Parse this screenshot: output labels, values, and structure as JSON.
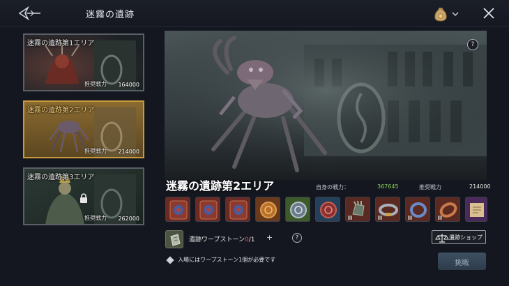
{
  "header": {
    "title": "迷霧の遺跡",
    "back_icon": "back-arrow-icon",
    "currency_icon": "money-bag-icon",
    "close_icon": "close-icon"
  },
  "areas": [
    {
      "name": "迷霧の遺跡第1エリア",
      "power_label": "推奨戦力",
      "power": "164000",
      "selected": false,
      "locked": false
    },
    {
      "name": "迷霧の遺跡第2エリア",
      "power_label": "推奨戦力",
      "power": "214000",
      "selected": true,
      "locked": false
    },
    {
      "name": "迷霧の遺跡第3エリア",
      "power_label": "推奨戦力",
      "power": "262000",
      "selected": false,
      "locked": true
    }
  ],
  "stage": {
    "title": "迷霧の遺跡第2エリア",
    "self_power_label": "自身の戦力：",
    "self_power": "367645",
    "recommended_label": "推奨戦力",
    "recommended": "214000",
    "help": "?"
  },
  "rewards": [
    {
      "icon": "monster-card-icon",
      "tier": ""
    },
    {
      "icon": "monster-card-icon",
      "tier": ""
    },
    {
      "icon": "monster-card-icon",
      "tier": ""
    },
    {
      "icon": "gold-coin-icon",
      "tier": ""
    },
    {
      "icon": "silver-coin-icon",
      "tier": ""
    },
    {
      "icon": "red-coin-icon",
      "tier": ""
    },
    {
      "icon": "gloves-icon",
      "tier": "II"
    },
    {
      "icon": "belt-icon",
      "tier": "II"
    },
    {
      "icon": "ring-icon",
      "tier": "II"
    },
    {
      "icon": "bracelet-icon",
      "tier": "II"
    },
    {
      "icon": "scroll-icon",
      "tier": ""
    }
  ],
  "warp": {
    "label": "遺跡ワープストーン",
    "current": "0",
    "total": "/1",
    "plus": "+",
    "help": "?"
  },
  "shop_button": "遺跡ショップ",
  "note": "入場にはワープストーン1個が必要です",
  "challenge_button": "挑戦"
}
